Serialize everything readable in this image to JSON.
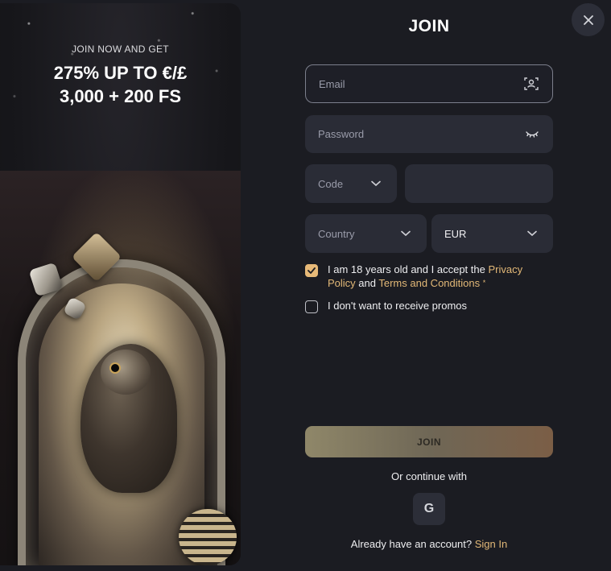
{
  "promo": {
    "subtitle": "JOIN NOW AND GET",
    "headline_line1": "275% UP TO €/£",
    "headline_line2": "3,000 + 200 FS"
  },
  "form": {
    "title": "JOIN",
    "close_icon": "close-icon",
    "email_placeholder": "Email",
    "email_icon": "user-scan-icon",
    "password_placeholder": "Password",
    "password_icon": "eye-closed-icon",
    "code_placeholder": "Code",
    "phone_value": "",
    "country_placeholder": "Country",
    "currency_value": "EUR",
    "dropdown_icon": "chevron-down-icon"
  },
  "terms": {
    "checked": true,
    "text_before": "I am 18 years old and I accept the ",
    "privacy_link": "Privacy Policy",
    "and_text": " and ",
    "terms_link": "Terms and Conditions",
    "required_mark": "*"
  },
  "promos_opt_out": {
    "checked": false,
    "text": "I don't want to receive promos"
  },
  "join_button": "JOIN",
  "or_continue": "Or continue with",
  "google_button": "G",
  "signin": {
    "prompt": "Already have an account?",
    "link": "Sign In"
  },
  "colors": {
    "background": "#1b1c22",
    "field": "#2a2c36",
    "accent": "#e2b877",
    "checkbox_checked": "#e7b978"
  }
}
